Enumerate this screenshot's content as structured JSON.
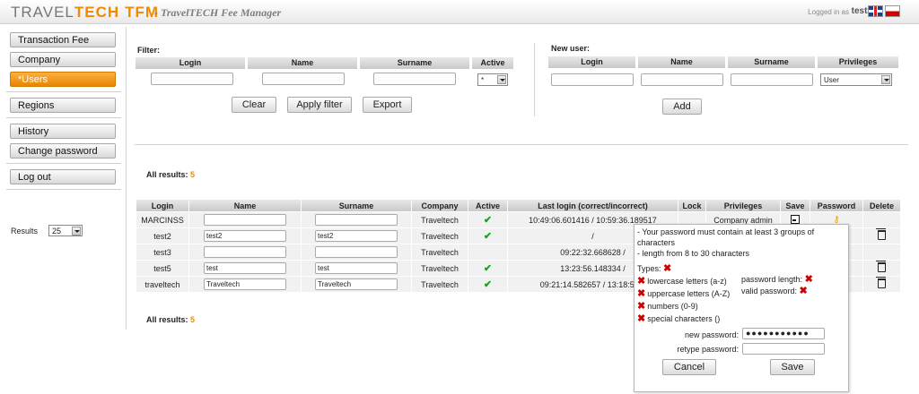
{
  "header": {
    "logo_a": "TRAVEL",
    "logo_b": "TECH",
    "logo_c": "TFM",
    "subtitle": "- TravelTECH Fee Manager",
    "logged_label": "Logged in as",
    "username": "test3"
  },
  "sidebar": {
    "items": [
      {
        "label": "Transaction Fee"
      },
      {
        "label": "Company"
      },
      {
        "label": "*Users"
      },
      {
        "label": "Regions"
      },
      {
        "label": "History"
      },
      {
        "label": "Change password"
      },
      {
        "label": "Log out"
      }
    ],
    "results_label": "Results",
    "results_value": "25"
  },
  "filter": {
    "title": "Filter:",
    "cols": [
      "Login",
      "Name",
      "Surname",
      "Active"
    ],
    "active_value": "*",
    "buttons": {
      "clear": "Clear",
      "apply": "Apply filter",
      "export": "Export"
    }
  },
  "new_user": {
    "title": "New user:",
    "cols": [
      "Login",
      "Name",
      "Surname",
      "Privileges"
    ],
    "privileges_value": "User",
    "add_label": "Add"
  },
  "all_results_label": "All results:",
  "all_results_count": "5",
  "table": {
    "headers": [
      "Login",
      "Name",
      "Surname",
      "Company",
      "Active",
      "Last login (correct/incorrect)",
      "Lock",
      "Privileges",
      "Save",
      "Password",
      "Delete"
    ],
    "rows": [
      {
        "login": "MARCINSS",
        "name": "",
        "surname": "",
        "company": "Traveltech",
        "active": true,
        "last": "10:49:06.601416 / 10:59:36.189517",
        "priv": "Company admin",
        "del": false
      },
      {
        "login": "test2",
        "name": "test2",
        "surname": "test2",
        "company": "Traveltech",
        "active": true,
        "last": "/",
        "priv": "",
        "del": true
      },
      {
        "login": "test3",
        "name": "",
        "surname": "",
        "company": "Traveltech",
        "active": false,
        "last": "09:22:32.668628 /",
        "priv": "",
        "del": false
      },
      {
        "login": "test5",
        "name": "test",
        "surname": "test",
        "company": "Traveltech",
        "active": true,
        "last": "13:23:56.148334 /",
        "priv": "",
        "del": true
      },
      {
        "login": "traveltech",
        "name": "Traveltech",
        "surname": "Traveltech",
        "company": "Traveltech",
        "active": true,
        "last": "09:21:14.582657 / 13:18:59.8",
        "priv": "",
        "del": true
      }
    ]
  },
  "popup": {
    "line1": "- Your password must contain at least 3 groups of",
    "line2": "characters",
    "line3": "- length from 8 to 30 characters",
    "types_label": "Types:",
    "types": [
      "lowercase letters (a-z)",
      "uppercase letters (A-Z)",
      "numbers (0-9)",
      "special characters ()"
    ],
    "length_label": "password length:",
    "valid_label": "valid password:",
    "new_pw_label": "new password:",
    "new_pw_value": "●●●●●●●●●●●",
    "retype_label": "retype password:",
    "retype_value": "",
    "cancel_label": "Cancel",
    "save_label": "Save"
  }
}
